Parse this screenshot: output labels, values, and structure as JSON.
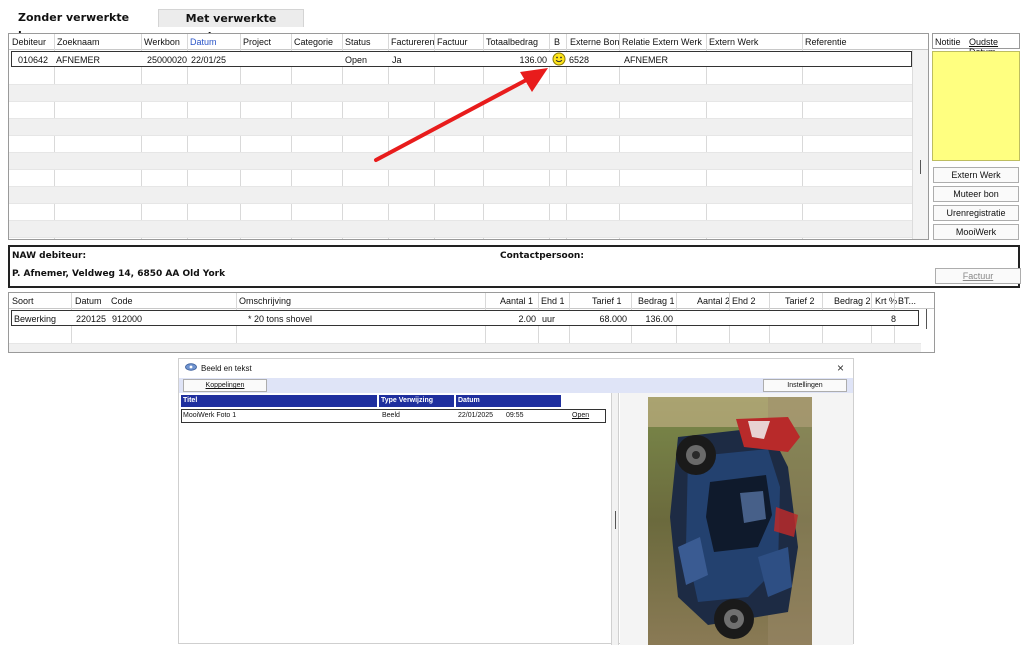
{
  "tabs": [
    {
      "label": "Zonder verwerkte bonnen"
    },
    {
      "label": "Met verwerkte bonnen"
    }
  ],
  "grid": {
    "headers": [
      "Debiteur",
      "Zoeknaam",
      "Werkbon",
      "Datum",
      "Project",
      "Categorie",
      "Status",
      "Factureren",
      "Factuur",
      "Totaalbedrag",
      "B",
      "Externe Bon",
      "Relatie Extern Werk",
      "Extern Werk",
      "Referentie"
    ],
    "row": {
      "debiteur": "010642",
      "zoeknaam": "AFNEMER",
      "werkbon": "25000020",
      "datum": "22/01/25",
      "status": "Open",
      "factureren": "Ja",
      "totaalbedrag": "136.00",
      "externe_bon": "6528",
      "relatie_extern_werk": "AFNEMER"
    }
  },
  "side": {
    "notitie": "Notitie",
    "oudste_datum": "Oudste Datum",
    "buttons": [
      "Extern Werk",
      "Muteer bon",
      "Urenregistratie",
      "MooiWerk"
    ],
    "factuur": "Factuur"
  },
  "naw": {
    "label": "NAW debiteur:",
    "address": "P. Afnemer, Veldweg 14, 6850 AA Old York",
    "contact_label": "Contactpersoon:"
  },
  "lines": {
    "headers": [
      "Soort",
      "Datum",
      "Code",
      "Omschrijving",
      "Aantal 1",
      "Ehd 1",
      "Tarief 1",
      "Bedrag 1",
      "Aantal 2",
      "Ehd 2",
      "Tarief 2",
      "Bedrag 2",
      "Krt %",
      "BT..."
    ],
    "row": {
      "soort": "Bewerking",
      "datum": "220125",
      "code": "912000",
      "omschrijving": "* 20 tons shovel",
      "aantal1": "2.00",
      "ehd1": "uur",
      "tarief1": "68.000",
      "bedrag1": "136.00",
      "bt": "8"
    }
  },
  "popup": {
    "title": "Beeld en tekst",
    "close": "×",
    "koppelingen": "Koppelingen",
    "instellingen": "Instellingen",
    "headers": [
      "Titel",
      "Type Verwijzing",
      "Datum"
    ],
    "row": {
      "titel": "MooiWerk Foto 1",
      "type": "Beeld",
      "datum": "22/01/2025",
      "tijd": "09:55",
      "open": "Open"
    }
  },
  "colors": {
    "accent_blue": "#1f2f9e",
    "note_yellow": "#ffff80",
    "arrow_red": "#e81c1c",
    "datum_header_blue": "#2a55c8"
  },
  "icons": [
    "smiley-icon",
    "eye-icon",
    "close-icon",
    "red-arrow-annotation",
    "car-photo"
  ]
}
